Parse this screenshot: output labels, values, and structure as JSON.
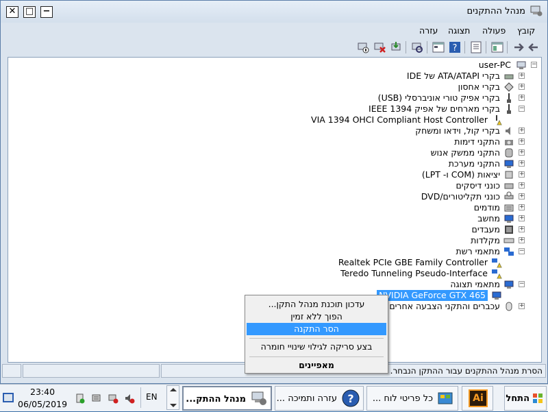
{
  "window": {
    "title": "מנהל ההתקנים"
  },
  "menu": {
    "file": "קובץ",
    "action": "פעולה",
    "view": "תצוגה",
    "help": "עזרה"
  },
  "tree": {
    "root": "user-PC",
    "items": [
      "בקרי ATA/ATAPI של IDE",
      "בקרי אחסון",
      "בקרי אפיק טורי אוניברסלי (USB)",
      "בקרי מארחים של אפיק IEEE 1394",
      "VIA 1394 OHCI Compliant Host Controller",
      "בקרי קול, וידאו ומשחק",
      "התקני דימות",
      "התקני ממשק אנוש",
      "התקני מערכת",
      "יציאות (COM ו- LPT)",
      "כונני דיסקים",
      "כונני תקליטורים/DVD",
      "מודמים",
      "מחשב",
      "מעבדים",
      "מקלדות",
      "מתאמי רשת",
      "Realtek PCIe GBE Family Controller",
      "Teredo Tunneling Pseudo-Interface",
      "מתאמי תצוגה",
      "NVIDIA GeForce GTX 465",
      "עכברים והתקני הצבעה אחרים"
    ]
  },
  "context_menu": {
    "update": "עדכון תוכנת מנהל התקן...",
    "disable": "הפוך ללא זמין",
    "uninstall": "הסר התקנה",
    "scan": "בצע סריקה לגילוי שינויי חומרה",
    "properties": "מאפיינים"
  },
  "status": {
    "text": "הסרת מנהל ההתקנים עבור ההתקן הנבחר."
  },
  "taskbar": {
    "start": "התחל",
    "app_ai": "Ai",
    "control_panel": "כל פריטי לוח ...",
    "help": "עזרה ותמיכה ...",
    "device_manager": "מנהל ההתק...",
    "lang": "EN",
    "time": "23:40",
    "date": "06/05/2019"
  },
  "colors": {
    "selection": "#3399ff",
    "taskbar_bg": "#eef2f7"
  }
}
